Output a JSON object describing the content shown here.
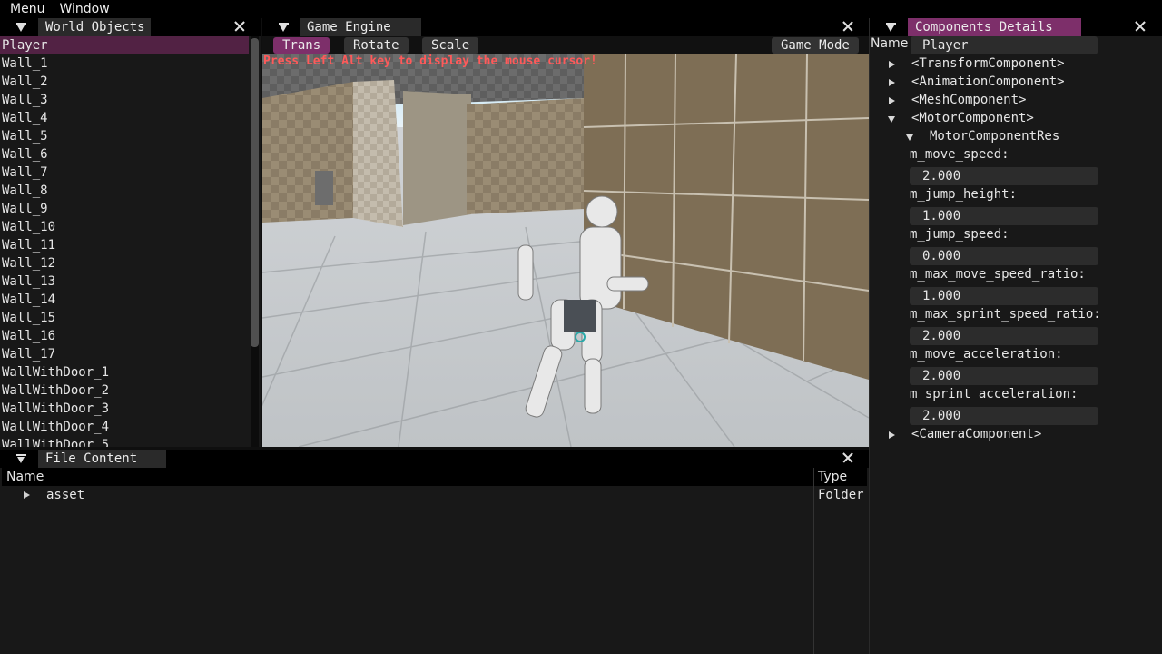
{
  "menu": [
    "Menu",
    "Window"
  ],
  "world_objects": {
    "title": "World Objects",
    "items": [
      "Player",
      "Wall_1",
      "Wall_2",
      "Wall_3",
      "Wall_4",
      "Wall_5",
      "Wall_6",
      "Wall_7",
      "Wall_8",
      "Wall_9",
      "Wall_10",
      "Wall_11",
      "Wall_12",
      "Wall_13",
      "Wall_14",
      "Wall_15",
      "Wall_16",
      "Wall_17",
      "WallWithDoor_1",
      "WallWithDoor_2",
      "WallWithDoor_3",
      "WallWithDoor_4",
      "WallWithDoor_5"
    ],
    "selected": "Player"
  },
  "game_engine": {
    "title": "Game Engine",
    "tools": [
      "Trans",
      "Rotate",
      "Scale"
    ],
    "active_tool": "Trans",
    "mode_button": "Game Mode",
    "hint": "Press Left Alt key to display the mouse cursor!"
  },
  "file_content": {
    "title": "File Content",
    "columns": [
      "Name",
      "Type"
    ],
    "rows": [
      {
        "name": "asset",
        "type": "Folder"
      }
    ]
  },
  "components": {
    "title": "Components Details",
    "name_label": "Name",
    "name_value": "Player",
    "transform": "<TransformComponent>",
    "animation": "<AnimationComponent>",
    "mesh": "<MeshComponent>",
    "motor": "<MotorComponent>",
    "motor_res": "MotorComponentRes",
    "camera": "<CameraComponent>",
    "fields": [
      {
        "label": "m_move_speed:",
        "value": "2.000"
      },
      {
        "label": "m_jump_height:",
        "value": "1.000"
      },
      {
        "label": "m_jump_speed:",
        "value": "0.000"
      },
      {
        "label": "m_max_move_speed_ratio:",
        "value": "1.000"
      },
      {
        "label": "m_max_sprint_speed_ratio:",
        "value": "2.000"
      },
      {
        "label": "m_move_acceleration:",
        "value": "2.000"
      },
      {
        "label": "m_sprint_acceleration:",
        "value": "2.000"
      }
    ]
  },
  "colors": {
    "accent": "#7d2f6a",
    "selected_row": "#522244",
    "hint": "#ff5a5a"
  }
}
